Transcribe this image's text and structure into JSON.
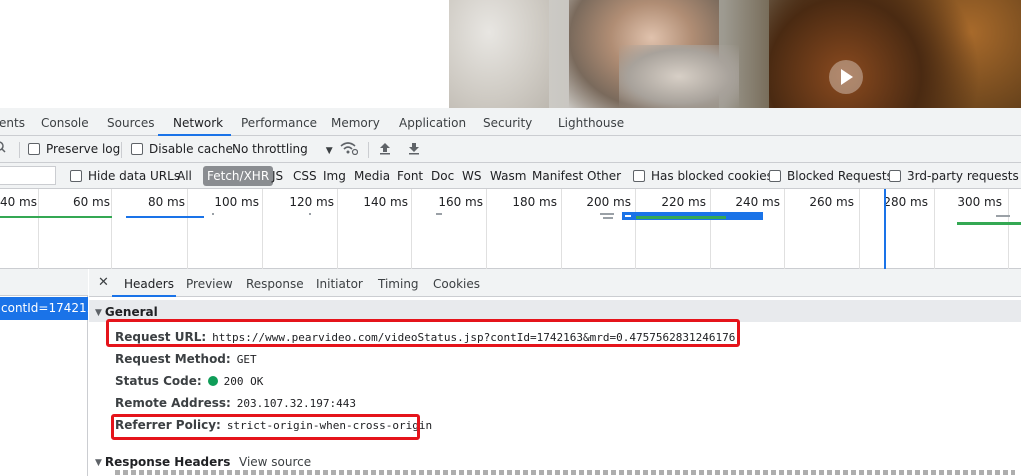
{
  "devtools": {
    "panel_tabs": [
      "ents",
      "Console",
      "Sources",
      "Network",
      "Performance",
      "Memory",
      "Application",
      "Security",
      "Lighthouse"
    ],
    "active_panel": "Network",
    "toolbar": {
      "preserve_log": "Preserve log",
      "disable_cache": "Disable cache",
      "throttling": "No throttling"
    },
    "filter": {
      "hide_data_urls": "Hide data URLs",
      "types": [
        "All",
        "Fetch/XHR",
        "JS",
        "CSS",
        "Img",
        "Media",
        "Font",
        "Doc",
        "WS",
        "Wasm",
        "Manifest",
        "Other"
      ],
      "active_type": "Fetch/XHR",
      "has_blocked_cookies": "Has blocked cookies",
      "blocked_requests": "Blocked Requests",
      "third_party": "3rd-party requests"
    },
    "overview": {
      "ticks": [
        "40 ms",
        "60 ms",
        "80 ms",
        "100 ms",
        "120 ms",
        "140 ms",
        "160 ms",
        "180 ms",
        "200 ms",
        "220 ms",
        "240 ms",
        "260 ms",
        "280 ms",
        "300 ms"
      ]
    },
    "request_list": {
      "selected": "contId=17421..."
    },
    "details": {
      "tabs": [
        "Headers",
        "Preview",
        "Response",
        "Initiator",
        "Timing",
        "Cookies"
      ],
      "active_tab": "Headers",
      "general_label": "General",
      "general": [
        {
          "key": "Request URL:",
          "value": "https://www.pearvideo.com/videoStatus.jsp?contId=1742163&mrd=0.4757562831246176"
        },
        {
          "key": "Request Method:",
          "value": "GET"
        },
        {
          "key": "Status Code:",
          "value": "200 OK"
        },
        {
          "key": "Remote Address:",
          "value": "203.107.32.197:443"
        },
        {
          "key": "Referrer Policy:",
          "value": "strict-origin-when-cross-origin"
        }
      ],
      "response_headers_label": "Response Headers",
      "view_source": "View source"
    }
  },
  "colors": {
    "accent": "#1a73e8",
    "highlight_box": "#e5141b",
    "status_ok": "#0f9d58"
  }
}
